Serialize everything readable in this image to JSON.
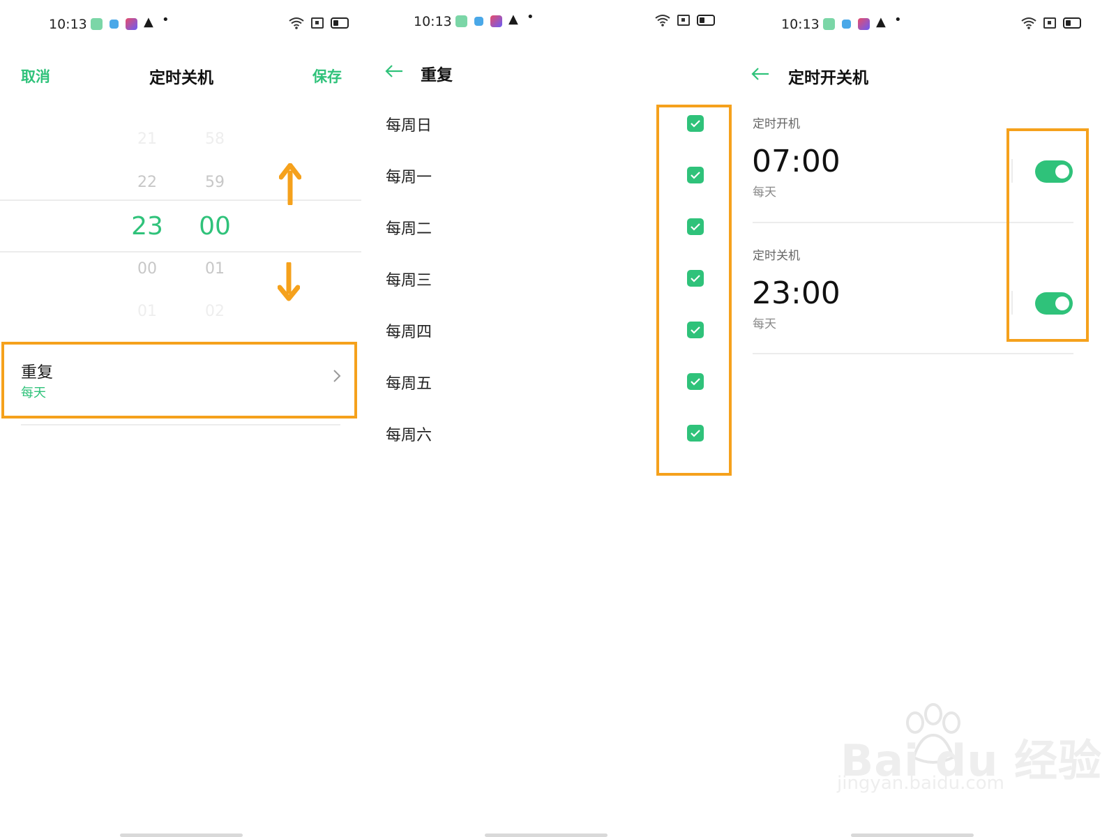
{
  "status_bar": {
    "time": "10:13"
  },
  "colors": {
    "accent": "#2fc27a",
    "highlight": "#f5a11c"
  },
  "panel1": {
    "cancel_label": "取消",
    "title": "定时关机",
    "save_label": "保存",
    "picker": {
      "hours": [
        "21",
        "22",
        "23",
        "00",
        "01"
      ],
      "minutes": [
        "58",
        "59",
        "00",
        "01",
        "02"
      ],
      "selected_hour": "23",
      "selected_minute": "00"
    },
    "repeat": {
      "label": "重复",
      "value": "每天"
    }
  },
  "panel2": {
    "title": "重复",
    "days": [
      {
        "label": "每周日",
        "checked": true
      },
      {
        "label": "每周一",
        "checked": true
      },
      {
        "label": "每周二",
        "checked": true
      },
      {
        "label": "每周三",
        "checked": true
      },
      {
        "label": "每周四",
        "checked": true
      },
      {
        "label": "每周五",
        "checked": true
      },
      {
        "label": "每周六",
        "checked": true
      }
    ]
  },
  "panel3": {
    "title": "定时开关机",
    "power_on": {
      "label": "定时开机",
      "time": "07:00",
      "repeat": "每天",
      "enabled": true
    },
    "power_off": {
      "label": "定时关机",
      "time": "23:00",
      "repeat": "每天",
      "enabled": true
    }
  },
  "watermark": {
    "brand": "Bai du 经验",
    "url": "jingyan.baidu.com"
  }
}
